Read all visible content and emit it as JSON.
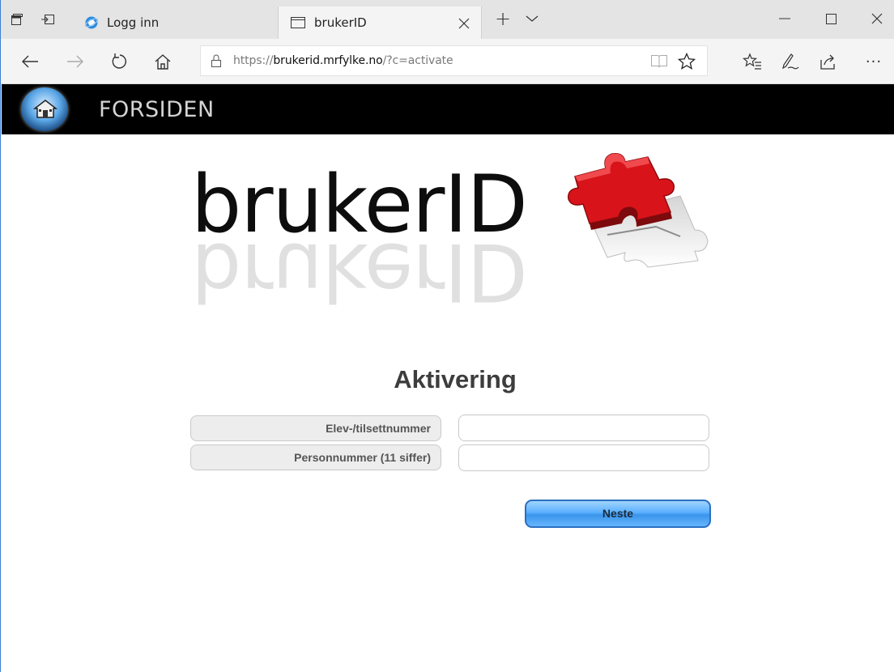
{
  "browser": {
    "tabs": [
      {
        "label": "Logg inn",
        "active": false
      },
      {
        "label": "brukerID",
        "active": true
      }
    ],
    "new_tab_label": "+",
    "url": {
      "prefix": "https://",
      "host": "brukerid.mrfylke.no",
      "path": "/?c=activate"
    },
    "window_controls": {
      "minimize": "—",
      "maximize": "☐",
      "close": "✕"
    },
    "more_label": "···"
  },
  "site": {
    "header_title": "FORSIDEN",
    "logo_text": "brukerID",
    "accent_color": "#e31e24"
  },
  "form": {
    "heading": "Aktivering",
    "fields": [
      {
        "label": "Elev-/tilsettnummer",
        "value": ""
      },
      {
        "label": "Personnummer (11 siffer)",
        "value": ""
      }
    ],
    "submit_label": "Neste"
  }
}
